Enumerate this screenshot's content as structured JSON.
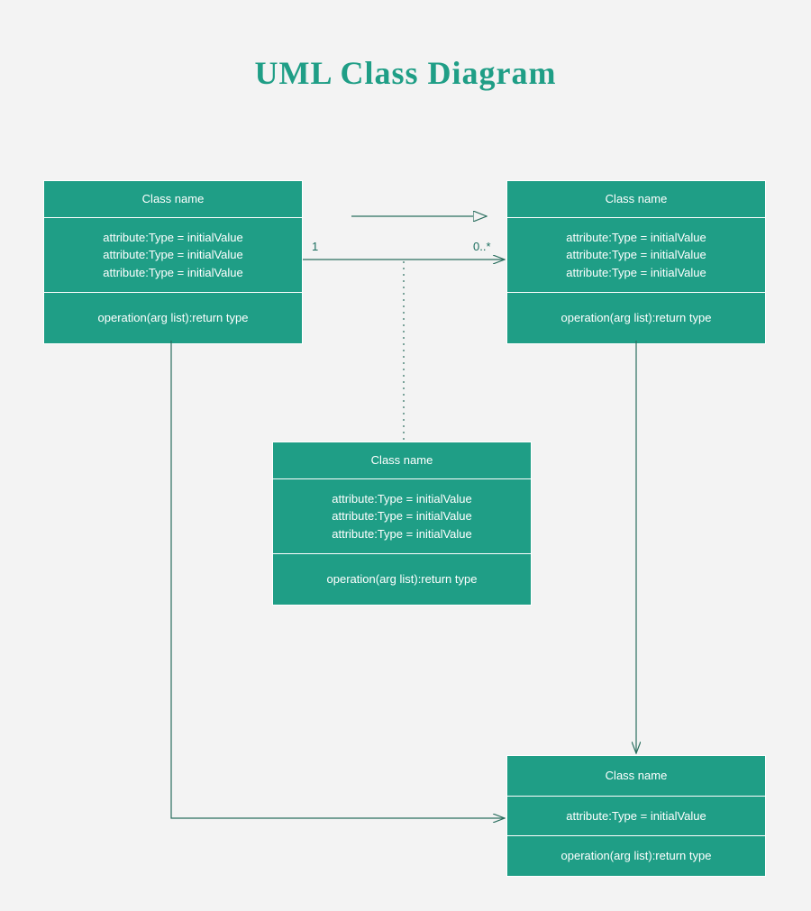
{
  "title": "UML Class Diagram",
  "colors": {
    "teal": "#1f9e86",
    "bg": "#f3f3f3"
  },
  "classes": {
    "c1": {
      "name": "Class name",
      "attrs": [
        "attribute:Type = initialValue",
        "attribute:Type = initialValue",
        "attribute:Type = initialValue"
      ],
      "ops": [
        "operation(arg list):return type"
      ]
    },
    "c2": {
      "name": "Class name",
      "attrs": [
        "attribute:Type = initialValue",
        "attribute:Type = initialValue",
        "attribute:Type = initialValue"
      ],
      "ops": [
        "operation(arg list):return type"
      ]
    },
    "c3": {
      "name": "Class name",
      "attrs": [
        "attribute:Type = initialValue",
        "attribute:Type = initialValue",
        "attribute:Type = initialValue"
      ],
      "ops": [
        "operation(arg list):return type"
      ]
    },
    "c4": {
      "name": "Class name",
      "attrs": [
        "attribute:Type = initialValue"
      ],
      "ops": [
        "operation(arg list):return type"
      ]
    }
  },
  "connectors": {
    "assoc_mult_left": "1",
    "assoc_mult_right": "0..*"
  }
}
